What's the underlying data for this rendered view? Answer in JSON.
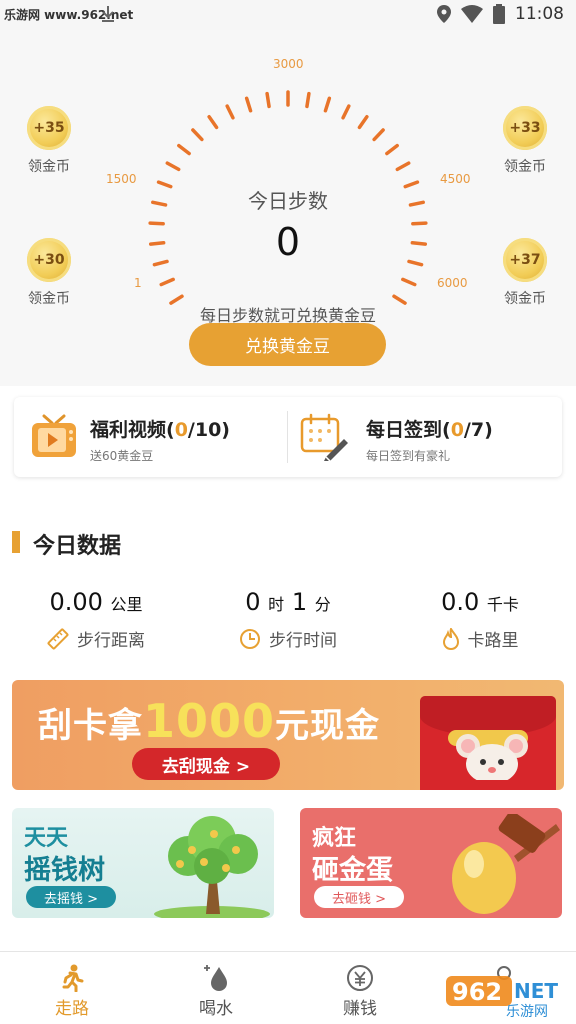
{
  "status_bar": {
    "watermark": "乐游网 www.962.net",
    "time": "11:08",
    "icons": [
      "download-icon",
      "location-icon",
      "wifi-icon",
      "battery-icon"
    ]
  },
  "gauge": {
    "title": "今日步数",
    "steps": "0",
    "description": "每日步数就可兑换黄金豆",
    "scale_labels": [
      "1",
      "1500",
      "3000",
      "4500",
      "6000"
    ],
    "accent_color": "#e8742a"
  },
  "coins": [
    {
      "value": "+35",
      "label": "领金币"
    },
    {
      "value": "+33",
      "label": "领金币"
    },
    {
      "value": "+30",
      "label": "领金币"
    },
    {
      "value": "+37",
      "label": "领金币"
    }
  ],
  "exchange_button": "兑换黄金豆",
  "tasks": [
    {
      "title_prefix": "福利视频(",
      "progress": "0",
      "title_suffix": "/10)",
      "subtitle": "送60黄金豆",
      "icon": "tv-play-icon"
    },
    {
      "title_prefix": "每日签到(",
      "progress": "0",
      "title_suffix": "/7)",
      "subtitle": "每日签到有豪礼",
      "icon": "calendar-sign-icon"
    }
  ],
  "today_section": {
    "title": "今日数据",
    "stats": [
      {
        "value": "0.00",
        "unit": "公里",
        "label": "步行距离",
        "icon": "ruler-icon"
      },
      {
        "value_a": "0",
        "unit_a": "时",
        "value_b": "1",
        "unit_b": "分",
        "label": "步行时间",
        "icon": "clock-icon"
      },
      {
        "value": "0.0",
        "unit": "千卡",
        "label": "卡路里",
        "icon": "flame-icon"
      }
    ]
  },
  "banners": {
    "scratch": {
      "prefix": "刮卡拿",
      "amount": "1000",
      "suffix": "元现金",
      "button": "去刮现金 >"
    },
    "money_tree": {
      "line1": "天天",
      "line2": "摇钱树",
      "button": "去摇钱 >"
    },
    "golden_egg": {
      "line1": "疯狂",
      "line2": "砸金蛋",
      "button": "去砸钱 >"
    }
  },
  "bottom_nav": [
    {
      "label": "走路",
      "icon": "walking-icon",
      "active": true
    },
    {
      "label": "喝水",
      "icon": "water-drop-icon",
      "active": false
    },
    {
      "label": "赚钱",
      "icon": "yuan-coin-icon",
      "active": false
    },
    {
      "label": "",
      "icon": "profile-icon",
      "active": false
    }
  ],
  "colors": {
    "primary": "#e7a133",
    "highlight": "#e89a2c",
    "banner_red": "#d4272a"
  },
  "footer_watermark": {
    "brand": "962",
    "suffix": "NET",
    "site": "乐游网"
  }
}
